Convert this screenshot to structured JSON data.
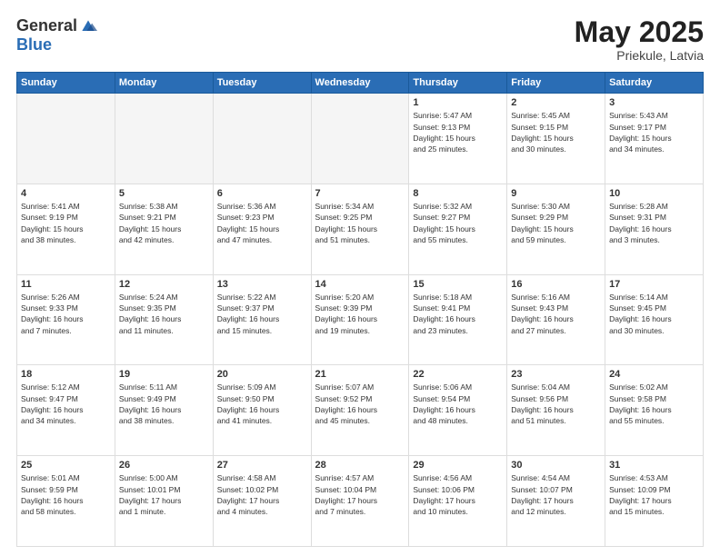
{
  "header": {
    "logo_general": "General",
    "logo_blue": "Blue",
    "month_year": "May 2025",
    "location": "Priekule, Latvia"
  },
  "weekdays": [
    "Sunday",
    "Monday",
    "Tuesday",
    "Wednesday",
    "Thursday",
    "Friday",
    "Saturday"
  ],
  "weeks": [
    [
      {
        "day": "",
        "info": "",
        "empty": true
      },
      {
        "day": "",
        "info": "",
        "empty": true
      },
      {
        "day": "",
        "info": "",
        "empty": true
      },
      {
        "day": "",
        "info": "",
        "empty": true
      },
      {
        "day": "1",
        "info": "Sunrise: 5:47 AM\nSunset: 9:13 PM\nDaylight: 15 hours\nand 25 minutes."
      },
      {
        "day": "2",
        "info": "Sunrise: 5:45 AM\nSunset: 9:15 PM\nDaylight: 15 hours\nand 30 minutes."
      },
      {
        "day": "3",
        "info": "Sunrise: 5:43 AM\nSunset: 9:17 PM\nDaylight: 15 hours\nand 34 minutes."
      }
    ],
    [
      {
        "day": "4",
        "info": "Sunrise: 5:41 AM\nSunset: 9:19 PM\nDaylight: 15 hours\nand 38 minutes."
      },
      {
        "day": "5",
        "info": "Sunrise: 5:38 AM\nSunset: 9:21 PM\nDaylight: 15 hours\nand 42 minutes."
      },
      {
        "day": "6",
        "info": "Sunrise: 5:36 AM\nSunset: 9:23 PM\nDaylight: 15 hours\nand 47 minutes."
      },
      {
        "day": "7",
        "info": "Sunrise: 5:34 AM\nSunset: 9:25 PM\nDaylight: 15 hours\nand 51 minutes."
      },
      {
        "day": "8",
        "info": "Sunrise: 5:32 AM\nSunset: 9:27 PM\nDaylight: 15 hours\nand 55 minutes."
      },
      {
        "day": "9",
        "info": "Sunrise: 5:30 AM\nSunset: 9:29 PM\nDaylight: 15 hours\nand 59 minutes."
      },
      {
        "day": "10",
        "info": "Sunrise: 5:28 AM\nSunset: 9:31 PM\nDaylight: 16 hours\nand 3 minutes."
      }
    ],
    [
      {
        "day": "11",
        "info": "Sunrise: 5:26 AM\nSunset: 9:33 PM\nDaylight: 16 hours\nand 7 minutes."
      },
      {
        "day": "12",
        "info": "Sunrise: 5:24 AM\nSunset: 9:35 PM\nDaylight: 16 hours\nand 11 minutes."
      },
      {
        "day": "13",
        "info": "Sunrise: 5:22 AM\nSunset: 9:37 PM\nDaylight: 16 hours\nand 15 minutes."
      },
      {
        "day": "14",
        "info": "Sunrise: 5:20 AM\nSunset: 9:39 PM\nDaylight: 16 hours\nand 19 minutes."
      },
      {
        "day": "15",
        "info": "Sunrise: 5:18 AM\nSunset: 9:41 PM\nDaylight: 16 hours\nand 23 minutes."
      },
      {
        "day": "16",
        "info": "Sunrise: 5:16 AM\nSunset: 9:43 PM\nDaylight: 16 hours\nand 27 minutes."
      },
      {
        "day": "17",
        "info": "Sunrise: 5:14 AM\nSunset: 9:45 PM\nDaylight: 16 hours\nand 30 minutes."
      }
    ],
    [
      {
        "day": "18",
        "info": "Sunrise: 5:12 AM\nSunset: 9:47 PM\nDaylight: 16 hours\nand 34 minutes."
      },
      {
        "day": "19",
        "info": "Sunrise: 5:11 AM\nSunset: 9:49 PM\nDaylight: 16 hours\nand 38 minutes."
      },
      {
        "day": "20",
        "info": "Sunrise: 5:09 AM\nSunset: 9:50 PM\nDaylight: 16 hours\nand 41 minutes."
      },
      {
        "day": "21",
        "info": "Sunrise: 5:07 AM\nSunset: 9:52 PM\nDaylight: 16 hours\nand 45 minutes."
      },
      {
        "day": "22",
        "info": "Sunrise: 5:06 AM\nSunset: 9:54 PM\nDaylight: 16 hours\nand 48 minutes."
      },
      {
        "day": "23",
        "info": "Sunrise: 5:04 AM\nSunset: 9:56 PM\nDaylight: 16 hours\nand 51 minutes."
      },
      {
        "day": "24",
        "info": "Sunrise: 5:02 AM\nSunset: 9:58 PM\nDaylight: 16 hours\nand 55 minutes."
      }
    ],
    [
      {
        "day": "25",
        "info": "Sunrise: 5:01 AM\nSunset: 9:59 PM\nDaylight: 16 hours\nand 58 minutes."
      },
      {
        "day": "26",
        "info": "Sunrise: 5:00 AM\nSunset: 10:01 PM\nDaylight: 17 hours\nand 1 minute."
      },
      {
        "day": "27",
        "info": "Sunrise: 4:58 AM\nSunset: 10:02 PM\nDaylight: 17 hours\nand 4 minutes."
      },
      {
        "day": "28",
        "info": "Sunrise: 4:57 AM\nSunset: 10:04 PM\nDaylight: 17 hours\nand 7 minutes."
      },
      {
        "day": "29",
        "info": "Sunrise: 4:56 AM\nSunset: 10:06 PM\nDaylight: 17 hours\nand 10 minutes."
      },
      {
        "day": "30",
        "info": "Sunrise: 4:54 AM\nSunset: 10:07 PM\nDaylight: 17 hours\nand 12 minutes."
      },
      {
        "day": "31",
        "info": "Sunrise: 4:53 AM\nSunset: 10:09 PM\nDaylight: 17 hours\nand 15 minutes."
      }
    ]
  ]
}
